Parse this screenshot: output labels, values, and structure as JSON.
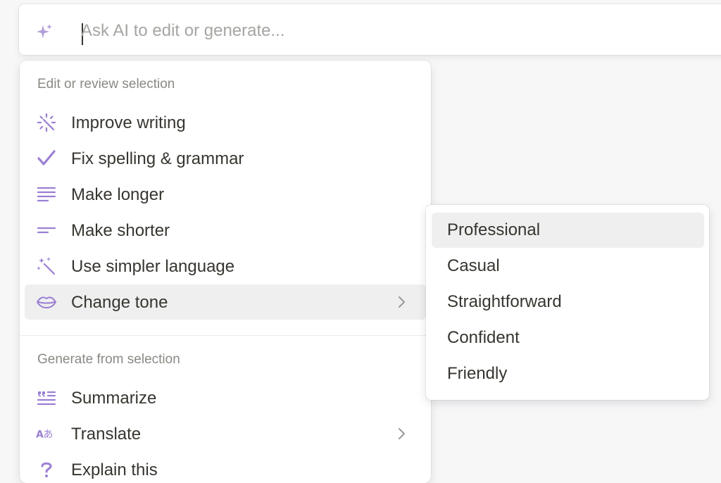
{
  "ai_input": {
    "placeholder": "Ask AI to edit or generate...",
    "value": ""
  },
  "colors": {
    "accent_purple": "#9b7fd4",
    "hover_bg": "#efefef",
    "section_label": "#8a8984",
    "text": "#37352f"
  },
  "menu": {
    "edit_section_label": "Edit or review selection",
    "edit_items": [
      {
        "label": "Improve writing",
        "icon": "improve-writing-icon"
      },
      {
        "label": "Fix spelling & grammar",
        "icon": "checkmark-icon"
      },
      {
        "label": "Make longer",
        "icon": "lines-long-icon"
      },
      {
        "label": "Make shorter",
        "icon": "lines-short-icon"
      },
      {
        "label": "Use simpler language",
        "icon": "magic-wand-icon"
      },
      {
        "label": "Change tone",
        "icon": "lips-icon",
        "has_submenu": true,
        "active": true
      }
    ],
    "generate_section_label": "Generate from selection",
    "generate_items": [
      {
        "label": "Summarize",
        "icon": "summarize-quote-icon"
      },
      {
        "label": "Translate",
        "icon": "translate-icon",
        "has_submenu": true
      },
      {
        "label": "Explain this",
        "icon": "question-mark-icon"
      }
    ]
  },
  "tone_submenu": {
    "items": [
      {
        "label": "Professional",
        "active": true
      },
      {
        "label": "Casual"
      },
      {
        "label": "Straightforward"
      },
      {
        "label": "Confident"
      },
      {
        "label": "Friendly"
      }
    ]
  }
}
